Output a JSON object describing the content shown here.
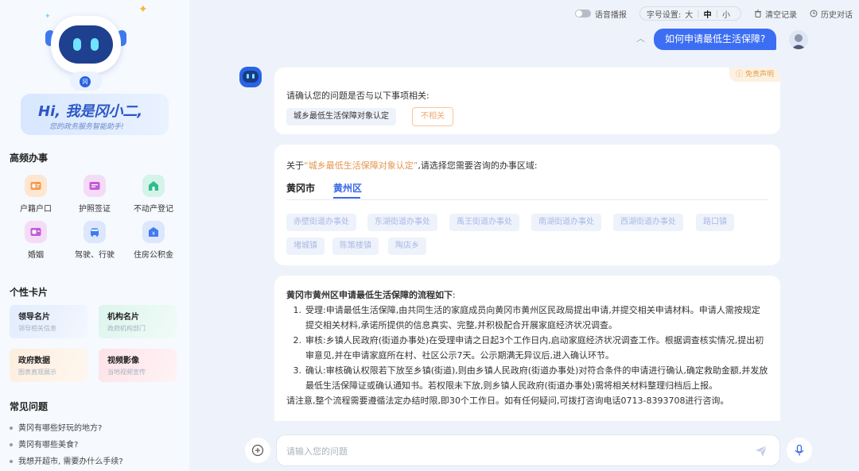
{
  "sidebar": {
    "hero": {
      "badge": "冈",
      "title": "Hi, 我是冈小二,",
      "subtitle": "您的政务服务智能助手!"
    },
    "frequent_title": "高频办事",
    "frequent_items": [
      {
        "label": "户籍户口",
        "icon": "id-card-icon",
        "color": "#f59a4a"
      },
      {
        "label": "护照签证",
        "icon": "passport-icon",
        "color": "#c25bd8"
      },
      {
        "label": "不动产登记",
        "icon": "house-icon",
        "color": "#2ebd8f"
      },
      {
        "label": "婚姻",
        "icon": "marriage-certificate-icon",
        "color": "#c25bd8"
      },
      {
        "label": "驾驶、行驶",
        "icon": "car-icon",
        "color": "#3f7af0"
      },
      {
        "label": "住房公积金",
        "icon": "housing-fund-icon",
        "color": "#3f7af0"
      }
    ],
    "cards_title": "个性卡片",
    "cards": [
      {
        "title": "领导名片",
        "sub": "领导相关信息"
      },
      {
        "title": "机构名片",
        "sub": "政府机构部门"
      },
      {
        "title": "政府数据",
        "sub": "图表直观展示"
      },
      {
        "title": "视频影像",
        "sub": "当地视频宣传"
      }
    ],
    "faq_title": "常见问题",
    "faq": [
      "黄冈有哪些好玩的地方?",
      "黄冈有哪些美食?",
      "我想开超市, 需要办什么手续?"
    ]
  },
  "topbar": {
    "voice": "语音播报",
    "font_label": "字号设置:",
    "font_sizes": [
      "大",
      "中",
      "小"
    ],
    "font_selected": "中",
    "clear": "清空记录",
    "history": "历史对话"
  },
  "chat": {
    "user_question": "如何申请最低生活保障?",
    "disclaimer": "免责声明",
    "confirm_text": "请确认您的问题是否与以下事项相关:",
    "confirm_item": "城乡最低生活保障对象认定",
    "not_related": "不相关",
    "region_prefix": "关于",
    "region_topic": "“城乡最低生活保障对象认定”",
    "region_suffix": ",请选择您需要咨询的办事区域:",
    "tabs": [
      "黄冈市",
      "黄州区"
    ],
    "active_tab": "黄州区",
    "regions": [
      "赤壁街道办事处",
      "东湖街道办事处",
      "禹王街道办事处",
      "南湖街道办事处",
      "西湖街道办事处",
      "路口镇",
      "堵城镇",
      "陈策楼镇",
      "陶店乡"
    ],
    "answer": {
      "title": "黄冈市黄州区申请最低生活保障的流程如下",
      "steps": [
        {
          "num": "1.",
          "text": "受理:申请最低生活保障,由共同生活的家庭成员向黄冈市黄州区民政局提出申请,并提交相关申请材料。申请人需按规定提交相关材料,承诺所提供的信息真实、完整,并积极配合开展家庭经济状况调查。"
        },
        {
          "num": "2.",
          "text": "审核:乡镇人民政府(街道办事处)在受理申请之日起3个工作日内,启动家庭经济状况调查工作。根据调查核实情况,提出初审意见,并在申请家庭所在村、社区公示7天。公示期满无异议后,进入确认环节。"
        },
        {
          "num": "3.",
          "text": "确认:审核确认权限若下放至乡镇(街道),则由乡镇人民政府(街道办事处)对符合条件的申请进行确认,确定救助金额,并发放最低生活保障证或确认通知书。若权限未下放,则乡镇人民政府(街道办事处)需将相关材料整理归档后上报。"
        }
      ],
      "note": "请注意,整个流程需要遵循法定办结时限,即30个工作日。如有任何疑问,可拨打咨询电话0713-8393708进行咨询。"
    }
  },
  "input": {
    "placeholder": "请输入您的问题"
  },
  "colors": {
    "accent": "#3867e8",
    "user_bubble": "#3c6ef3",
    "highlight": "#e5954f"
  }
}
